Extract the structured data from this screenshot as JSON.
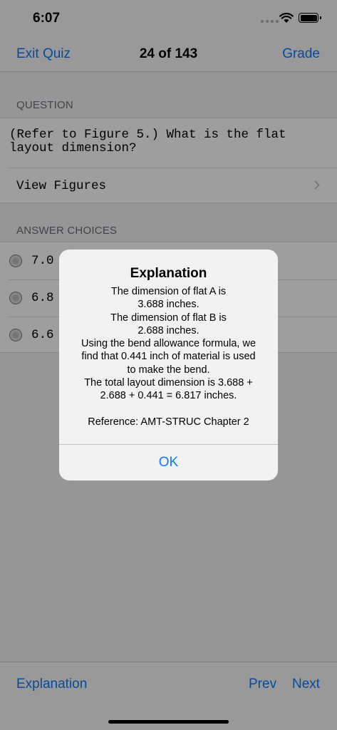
{
  "status_bar": {
    "time": "6:07"
  },
  "nav": {
    "left_label": "Exit Quiz",
    "title": "24 of 143",
    "right_label": "Grade"
  },
  "question": {
    "section_header": "QUESTION",
    "text": "(Refer to Figure 5.) What is the flat layout dimension?",
    "view_figures_label": "View Figures"
  },
  "answers": {
    "section_header": "ANSWER CHOICES",
    "items": [
      {
        "label": "7.0"
      },
      {
        "label": "6.8"
      },
      {
        "label": "6.6"
      }
    ]
  },
  "alert": {
    "title": "Explanation",
    "lines": [
      "The dimension of flat A is",
      "3.688 inches.",
      "The dimension of flat B is",
      "2.688 inches.",
      "Using the bend allowance formula, we",
      "find that 0.441 inch of material is used",
      "to make the bend.",
      "The total layout dimension is 3.688 +",
      "2.688 + 0.441 = 6.817 inches.",
      "",
      "Reference: AMT-STRUC Chapter 2"
    ],
    "ok_label": "OK"
  },
  "toolbar": {
    "explanation_label": "Explanation",
    "prev_label": "Prev",
    "next_label": "Next"
  },
  "colors": {
    "accent": "#0a7aff",
    "background": "#f2f2f7"
  }
}
